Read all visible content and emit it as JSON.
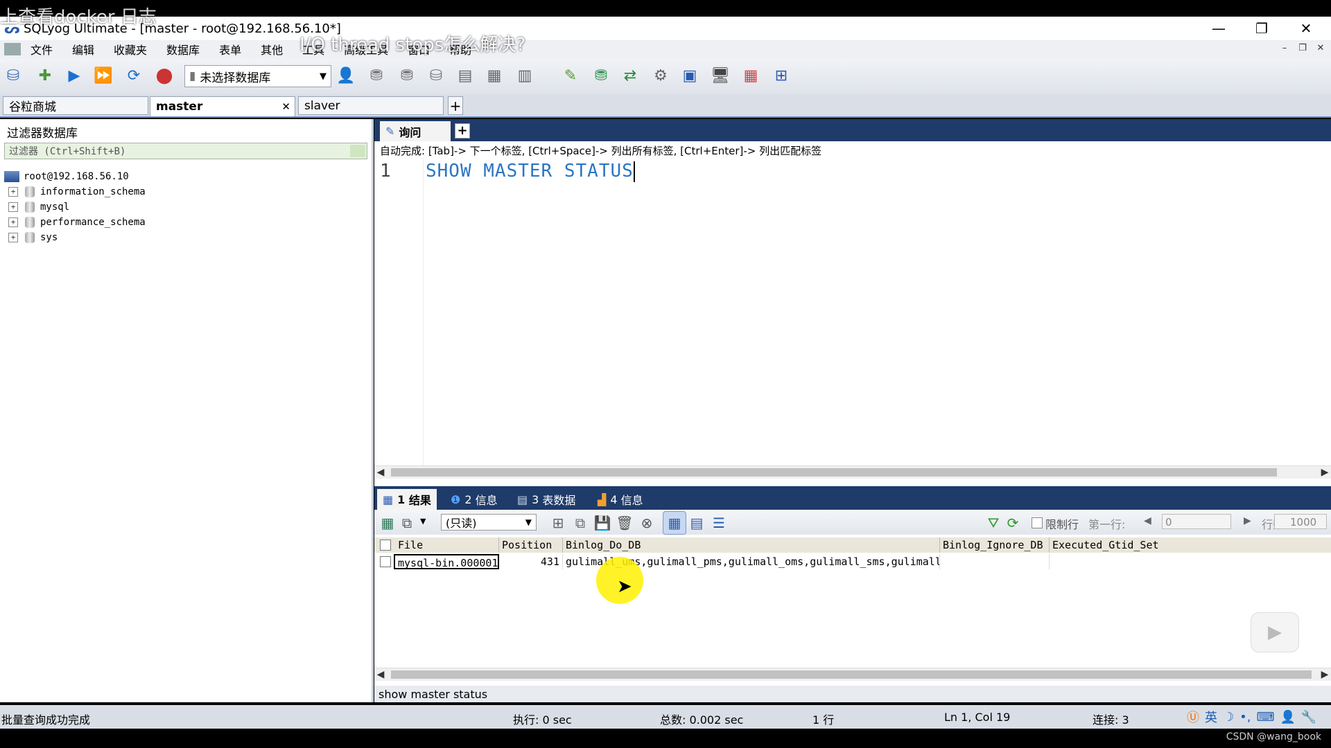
{
  "overlay": {
    "caption_top": "上查看docker 日志",
    "caption_mid": "I/O thread stops怎么解决?"
  },
  "window": {
    "title": "SQLyog Ultimate - [master - root@192.168.56.10*]",
    "minimize": "—",
    "restore": "❐",
    "close": "✕"
  },
  "menu": {
    "items": [
      "文件",
      "编辑",
      "收藏夹",
      "数据库",
      "表单",
      "其他",
      "工具",
      "高级工具",
      "窗口",
      "帮助"
    ],
    "mdi_min": "–",
    "mdi_restore": "❐",
    "mdi_close": "✕"
  },
  "toolbar": {
    "db_select": "未选择数据库"
  },
  "connections": {
    "tabs": [
      "谷粒商城",
      "master",
      "slaver"
    ],
    "close_glyph": "✕",
    "add": "+"
  },
  "object_browser": {
    "header": "过滤器数据库",
    "filter_placeholder": "过滤器 (Ctrl+Shift+B)",
    "root": "root@192.168.56.10",
    "databases": [
      "information_schema",
      "mysql",
      "performance_schema",
      "sys"
    ],
    "expander": "+"
  },
  "editor": {
    "tab_label": "询问",
    "autocomplete": "自动完成: [Tab]-> 下一个标签, [Ctrl+Space]-> 列出所有标签, [Ctrl+Enter]-> 列出匹配标签",
    "line_number": "1",
    "code": "SHOW MASTER STATUS"
  },
  "results": {
    "tabs": [
      {
        "num": "1",
        "label": "结果"
      },
      {
        "num": "2",
        "label": "信息"
      },
      {
        "num": "3",
        "label": "表数据"
      },
      {
        "num": "4",
        "label": "信息"
      }
    ],
    "mode_select": "(只读)",
    "limit_label": "限制行",
    "first_row_label": "第一行:",
    "first_row_value": "0",
    "rows_label": "行数:",
    "rows_value": "1000",
    "columns": [
      "File",
      "Position",
      "Binlog_Do_DB",
      "Binlog_Ignore_DB",
      "Executed_Gtid_Set"
    ],
    "rows": [
      [
        "mysql-bin.000001",
        "431",
        "gulimall_ums,gulimall_pms,gulimall_oms,gulimall_sms,gulimall_wms,gu",
        "",
        ""
      ]
    ],
    "query_echo": "show master status"
  },
  "status": {
    "message": "批量查询成功完成",
    "exec": "执行: 0 sec",
    "total": "总数: 0.002 sec",
    "rows": "1 行",
    "position": "Ln 1, Col 19",
    "connections": "连接: 3",
    "ime": "英"
  },
  "watermark": "CSDN @wang_book",
  "colors": {
    "accent_dark": "#1f3b6a",
    "code_blue": "#2b76c4",
    "highlight": "#fff000"
  }
}
